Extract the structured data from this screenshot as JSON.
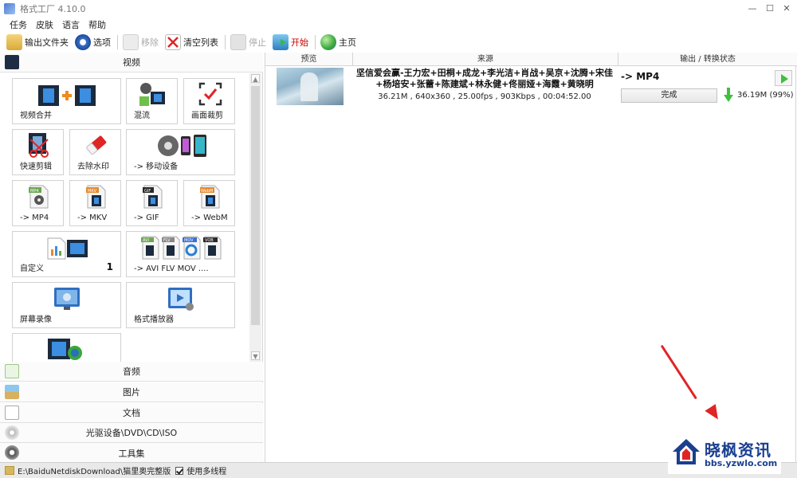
{
  "window": {
    "title": "格式工厂 4.10.0"
  },
  "menu": {
    "items": [
      "任务",
      "皮肤",
      "语言",
      "帮助"
    ]
  },
  "toolbar": {
    "output_folder": "输出文件夹",
    "options": "选项",
    "remove": "移除",
    "clear_list": "清空列表",
    "stop": "停止",
    "start": "开始",
    "home": "主页"
  },
  "categories": {
    "video": "视频",
    "audio": "音频",
    "image": "图片",
    "document": "文档",
    "disc": "光驱设备\\DVD\\CD\\ISO",
    "tools": "工具集"
  },
  "tiles": [
    {
      "label": "视频合并",
      "icon": "film-merge-icon"
    },
    {
      "label": "混流",
      "icon": "mux-icon"
    },
    {
      "label": "画面裁剪",
      "icon": "crop-icon"
    },
    {
      "label": "快速剪辑",
      "icon": "scissors-film-icon"
    },
    {
      "label": "去除水印",
      "icon": "eraser-icon"
    },
    {
      "label": "-> 移动设备",
      "icon": "mobile-device-icon"
    },
    {
      "label": "-> MP4",
      "icon": "mp4-file-icon",
      "badge": "MP4"
    },
    {
      "label": "-> MKV",
      "icon": "mkv-file-icon",
      "badge": "MKV"
    },
    {
      "label": "-> GIF",
      "icon": "gif-file-icon",
      "badge": "GIF"
    },
    {
      "label": "-> WebM",
      "icon": "webm-file-icon",
      "badge": "WebM"
    },
    {
      "label": "自定义",
      "icon": "custom-icon",
      "count": "1"
    },
    {
      "label": "-> AVI FLV MOV ....",
      "icon": "multi-format-icon",
      "badges": [
        "AVI",
        "FLV",
        "MOV",
        "VOB"
      ]
    },
    {
      "label": "屏幕录像",
      "icon": "screen-record-icon"
    },
    {
      "label": "格式播放器",
      "icon": "player-icon"
    },
    {
      "label": "",
      "icon": "video-download-icon"
    }
  ],
  "table": {
    "headers": {
      "preview": "预览",
      "source": "来源",
      "output": "输出 / 转换状态"
    },
    "rows": [
      {
        "title": "坚信爱会赢-王力宏+田桐+成龙+李光洁+肖战+吴京+沈腾+宋佳+杨培安+张蕾+陈建斌+林永健+佟丽娅+海霞+黄晓明",
        "meta": "36.21M , 640x360 , 25.00fps , 903Kbps , 00:04:52.00",
        "format": "-> MP4",
        "status": "完成",
        "output_size": "36.19M",
        "percent": "(99%)"
      }
    ]
  },
  "status_bar": {
    "path": "E:\\BaiduNetdiskDownload\\猫里奥完整版",
    "multithread": "使用多线程"
  },
  "watermark": {
    "name": "晓枫资讯",
    "url": "bbs.yzwlo.com"
  },
  "colors": {
    "accent_red": "#e02525",
    "brand_blue": "#1a3f8f",
    "play_green": "#3fbf3f"
  }
}
